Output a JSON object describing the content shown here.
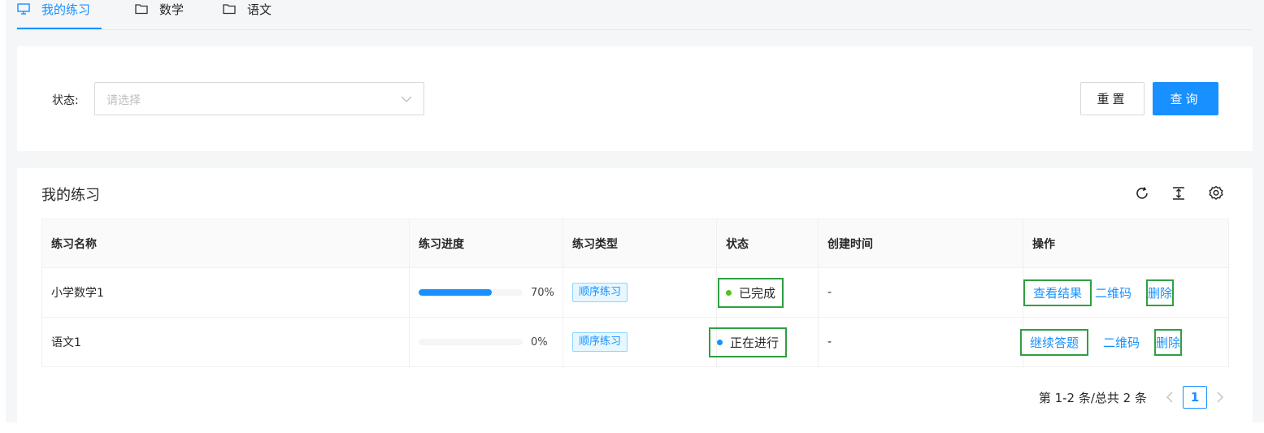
{
  "tabs": [
    {
      "label": "我的练习",
      "icon": "monitor-icon",
      "active": true
    },
    {
      "label": "数学",
      "icon": "folder-icon",
      "active": false
    },
    {
      "label": "语文",
      "icon": "folder-icon",
      "active": false
    }
  ],
  "search": {
    "status_label": "状态:",
    "status_placeholder": "请选择",
    "reset_label": "重置",
    "query_label": "查询"
  },
  "table": {
    "title": "我的练习",
    "columns": [
      "练习名称",
      "练习进度",
      "练习类型",
      "状态",
      "创建时间",
      "操作"
    ],
    "rows": [
      {
        "name": "小学数学1",
        "progress": 70,
        "progress_text": "70%",
        "type": "顺序练习",
        "status": "已完成",
        "status_color": "#52c41a",
        "created": "-",
        "primary_action": "查看结果",
        "qr_action": "二维码",
        "delete_action": "删除"
      },
      {
        "name": "语文1",
        "progress": 0,
        "progress_text": "0%",
        "type": "顺序练习",
        "status": "正在进行",
        "status_color": "#1890ff",
        "created": "-",
        "primary_action": "继续答题",
        "qr_action": "二维码",
        "delete_action": "删除"
      }
    ]
  },
  "pagination": {
    "total_text": "第 1-2 条/总共 2 条",
    "current_page": "1"
  },
  "colors": {
    "primary": "#1890ff",
    "success": "#52c41a",
    "highlight_box": "#2ea043"
  }
}
